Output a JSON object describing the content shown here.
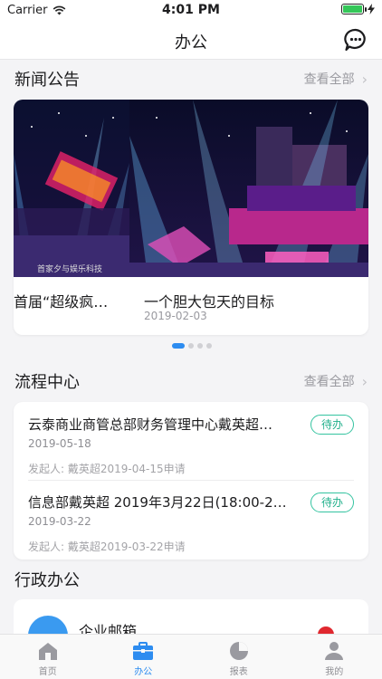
{
  "status_bar": {
    "carrier": "Carrier",
    "time": "4:01 PM",
    "battery_level": 1.0
  },
  "nav": {
    "title": "办公",
    "chat_icon": "chat-bubble-icon"
  },
  "news": {
    "title": "新闻公告",
    "view_all": "查看全部",
    "items": [
      {
        "caption": "首届“超级疯…",
        "date": "",
        "image_text": "首家夕与娱乐科技"
      },
      {
        "caption": "一个胆大包天的目标",
        "date": "2019-02-03",
        "image_text": ""
      }
    ],
    "pager": {
      "count": 4,
      "active_index": 0
    }
  },
  "flow": {
    "title": "流程中心",
    "view_all": "查看全部",
    "items": [
      {
        "title": "云泰商业商管总部财务管理中心戴英超…",
        "date": "2019-05-18",
        "initiator": "发起人: 戴英超2019-04-15申请",
        "status": "待办"
      },
      {
        "title": "信息部戴英超 2019年3月22日(18:00-2…",
        "date": "2019-03-22",
        "initiator": "发起人: 戴英超2019-03-22申请",
        "status": "待办"
      }
    ]
  },
  "admin": {
    "title": "行政办公",
    "items": [
      {
        "label": "企业邮箱",
        "icon": "mail-icon"
      }
    ]
  },
  "tabs": [
    {
      "label": "首页",
      "icon": "home-icon",
      "active": false
    },
    {
      "label": "办公",
      "icon": "briefcase-icon",
      "active": true
    },
    {
      "label": "报表",
      "icon": "pie-chart-icon",
      "active": false
    },
    {
      "label": "我的",
      "icon": "person-icon",
      "active": false
    }
  ],
  "colors": {
    "accent": "#2d8cf0",
    "badge_green": "#22b08c",
    "badge_red": "#e0282f"
  }
}
